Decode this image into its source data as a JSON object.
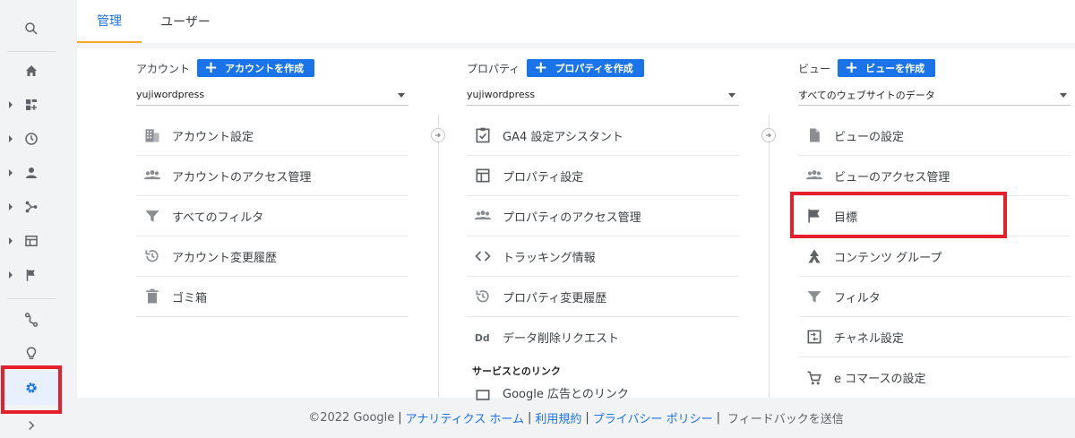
{
  "tabs": [
    {
      "label": "管理"
    },
    {
      "label": "ユーザー"
    }
  ],
  "account": {
    "title": "アカウント",
    "create": "アカウントを作成",
    "selected": "yujiwordpress",
    "items": [
      {
        "label": "アカウント設定",
        "icon": "building-icon"
      },
      {
        "label": "アカウントのアクセス管理",
        "icon": "group-icon"
      },
      {
        "label": "すべてのフィルタ",
        "icon": "filter-icon"
      },
      {
        "label": "アカウント変更履歴",
        "icon": "history-icon"
      },
      {
        "label": "ゴミ箱",
        "icon": "trash-icon"
      }
    ]
  },
  "property": {
    "title": "プロパティ",
    "create": "プロパティを作成",
    "selected": "yujiwordpress",
    "items": [
      {
        "label": "GA4 設定アシスタント",
        "icon": "clipboard-check-icon"
      },
      {
        "label": "プロパティ設定",
        "icon": "layout-icon"
      },
      {
        "label": "プロパティのアクセス管理",
        "icon": "group-icon"
      },
      {
        "label": "トラッキング情報",
        "icon": "code-icon"
      },
      {
        "label": "プロパティ変更履歴",
        "icon": "history-icon"
      },
      {
        "label": "データ削除リクエスト",
        "icon": "dd-icon"
      }
    ],
    "section": "サービスとのリンク",
    "partial_item": "Google 広告とのリンク"
  },
  "view": {
    "title": "ビュー",
    "create": "ビューを作成",
    "selected": "すべてのウェブサイトのデータ",
    "items": [
      {
        "label": "ビューの設定",
        "icon": "file-icon"
      },
      {
        "label": "ビューのアクセス管理",
        "icon": "group-icon"
      },
      {
        "label": "目標",
        "icon": "flag-icon"
      },
      {
        "label": "コンテンツ グループ",
        "icon": "content-group-icon"
      },
      {
        "label": "フィルタ",
        "icon": "filter-icon"
      },
      {
        "label": "チャネル設定",
        "icon": "channel-icon"
      },
      {
        "label": "e コマースの設定",
        "icon": "cart-icon"
      }
    ]
  },
  "footer": {
    "copyright": "©2022 Google",
    "links": [
      "アナリティクス ホーム",
      "利用規約",
      "プライバシー ポリシー"
    ],
    "feedback": "フィードバックを送信",
    "sep": "|"
  },
  "colors": {
    "accent": "#1a73e8",
    "highlight": "#e5202b",
    "tab_underline": "#f7a829"
  }
}
